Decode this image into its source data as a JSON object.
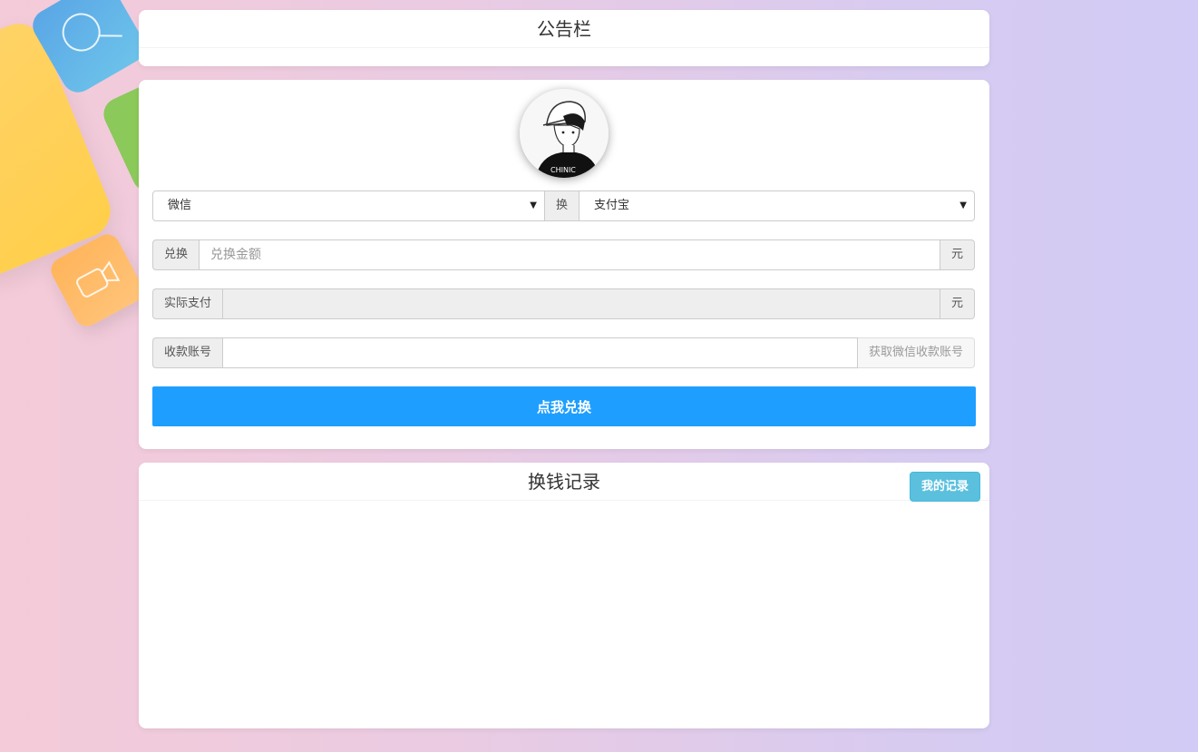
{
  "notice": {
    "title": "公告栏"
  },
  "exchange_form": {
    "from_select": {
      "value": "微信",
      "options": [
        "微信"
      ]
    },
    "swap_label": "换",
    "to_select": {
      "value": "支付宝",
      "options": [
        "支付宝"
      ]
    },
    "amount": {
      "label": "兑换",
      "placeholder": "兑换金额",
      "value": "",
      "unit": "元"
    },
    "actual": {
      "label": "实际支付",
      "value": "",
      "unit": "元"
    },
    "account": {
      "label": "收款账号",
      "value": "",
      "action": "获取微信收款账号"
    },
    "submit_label": "点我兑换"
  },
  "records": {
    "title": "换钱记录",
    "my_records_label": "我的记录"
  },
  "colors": {
    "primary": "#1e9fff",
    "info": "#5bc0de",
    "panel": "#ffffff"
  }
}
